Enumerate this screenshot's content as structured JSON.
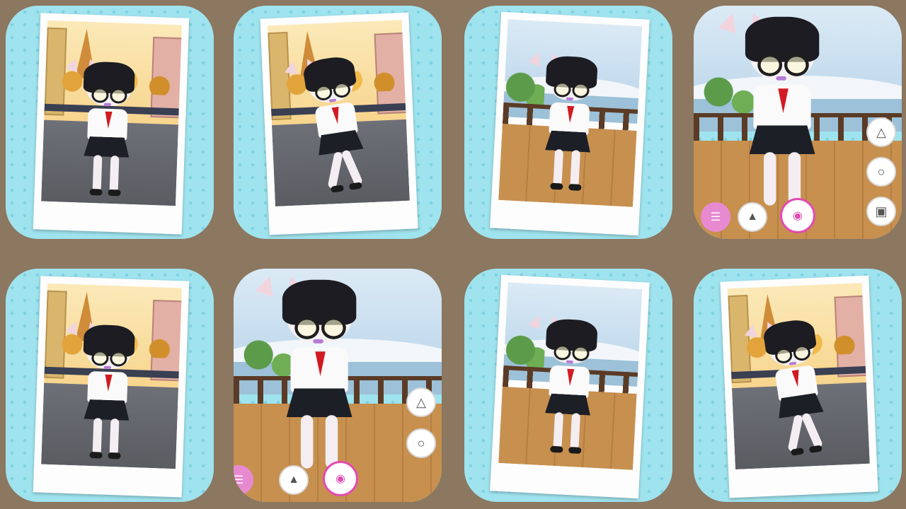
{
  "screen": {
    "background_color": "#8c7760",
    "tile_color": "#9fe3ee"
  },
  "tiles": [
    {
      "id": 1,
      "scene": "paris",
      "frame": "polaroid",
      "pose": "standing"
    },
    {
      "id": 2,
      "scene": "paris",
      "frame": "polaroid",
      "pose": "dancing"
    },
    {
      "id": 3,
      "scene": "snow-balcony",
      "frame": "polaroid",
      "pose": "standing"
    },
    {
      "id": 4,
      "scene": "snow-balcony",
      "frame": "app-view",
      "pose": "dancing",
      "side_buttons": [
        "dress-icon",
        "lips-icon",
        "photo-frame-icon"
      ],
      "bottom_buttons": [
        "settings-icon",
        "gallery-icon",
        "camera-icon"
      ]
    },
    {
      "id": 5,
      "scene": "paris",
      "frame": "polaroid",
      "pose": "standing"
    },
    {
      "id": 6,
      "scene": "snow-balcony",
      "frame": "app-view",
      "pose": "dancing",
      "side_buttons": [
        "dress-icon",
        "lips-icon"
      ],
      "bottom_buttons": [
        "settings-icon",
        "gallery-icon",
        "camera-icon"
      ]
    },
    {
      "id": 7,
      "scene": "snow-balcony",
      "frame": "polaroid",
      "pose": "standing"
    },
    {
      "id": 8,
      "scene": "paris",
      "frame": "polaroid",
      "pose": "dancing"
    }
  ]
}
